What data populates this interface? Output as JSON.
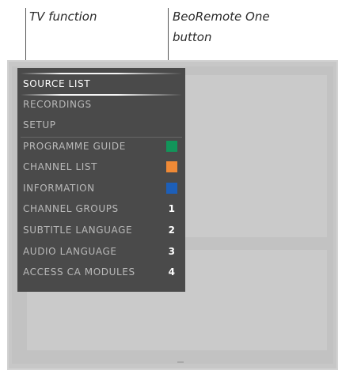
{
  "callouts": {
    "tv_function": "TV function",
    "remote_button_line1": "BeoRemote One",
    "remote_button_line2": "button"
  },
  "menu": {
    "items": [
      {
        "label": "SOURCE LIST",
        "active": true
      },
      {
        "label": "RECORDINGS"
      },
      {
        "label": "SETUP"
      },
      {
        "label": "PROGRAMME GUIDE",
        "button_color": "#12955a"
      },
      {
        "label": "CHANNEL LIST",
        "button_color": "#f08a36"
      },
      {
        "label": "INFORMATION",
        "button_color": "#1d5fb8"
      },
      {
        "label": "CHANNEL GROUPS",
        "button_digit": "1"
      },
      {
        "label": "SUBTITLE LANGUAGE",
        "button_digit": "2"
      },
      {
        "label": "AUDIO LANGUAGE",
        "button_digit": "3"
      },
      {
        "label": "ACCESS CA MODULES",
        "button_digit": "4"
      }
    ]
  },
  "colors": {
    "menu_background": "#4a4a4a",
    "menu_text": "#b9b9b9",
    "menu_active_text": "#ffffff",
    "tv_screen": "#c2c2c2",
    "green_button": "#12955a",
    "orange_button": "#f08a36",
    "blue_button": "#1d5fb8"
  },
  "icons": {
    "green_button": "green-square-icon",
    "orange_button": "orange-square-icon",
    "blue_button": "blue-square-icon"
  }
}
